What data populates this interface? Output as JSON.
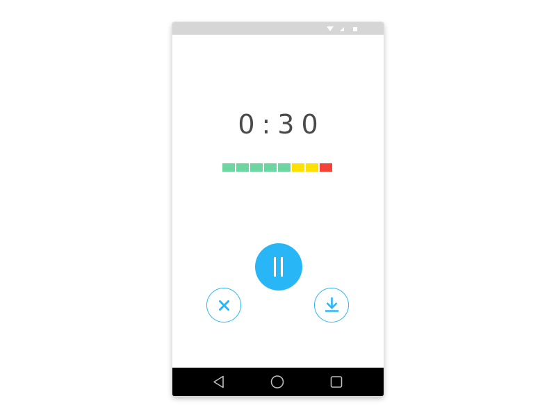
{
  "recorder": {
    "elapsed_time": "0:30",
    "level_meter": {
      "segment_colors": [
        "#6dd5a0",
        "#6dd5a0",
        "#6dd5a0",
        "#6dd5a0",
        "#6dd5a0",
        "#ffe000",
        "#ffe000",
        "#f44336"
      ]
    },
    "controls": {
      "pause_icon": "pause-icon",
      "cancel_icon": "close-icon",
      "save_icon": "download-icon"
    }
  },
  "status_bar": {
    "icons": [
      "wifi-icon",
      "cellular-signal-icon",
      "battery-icon"
    ]
  },
  "nav_bar": {
    "icons": [
      "back-icon",
      "home-icon",
      "recents-icon"
    ]
  },
  "colors": {
    "accent": "#29b6f6",
    "status_bar": "#d6d6d6",
    "nav_bar": "#000000",
    "timer_text": "#4a4a4a"
  }
}
